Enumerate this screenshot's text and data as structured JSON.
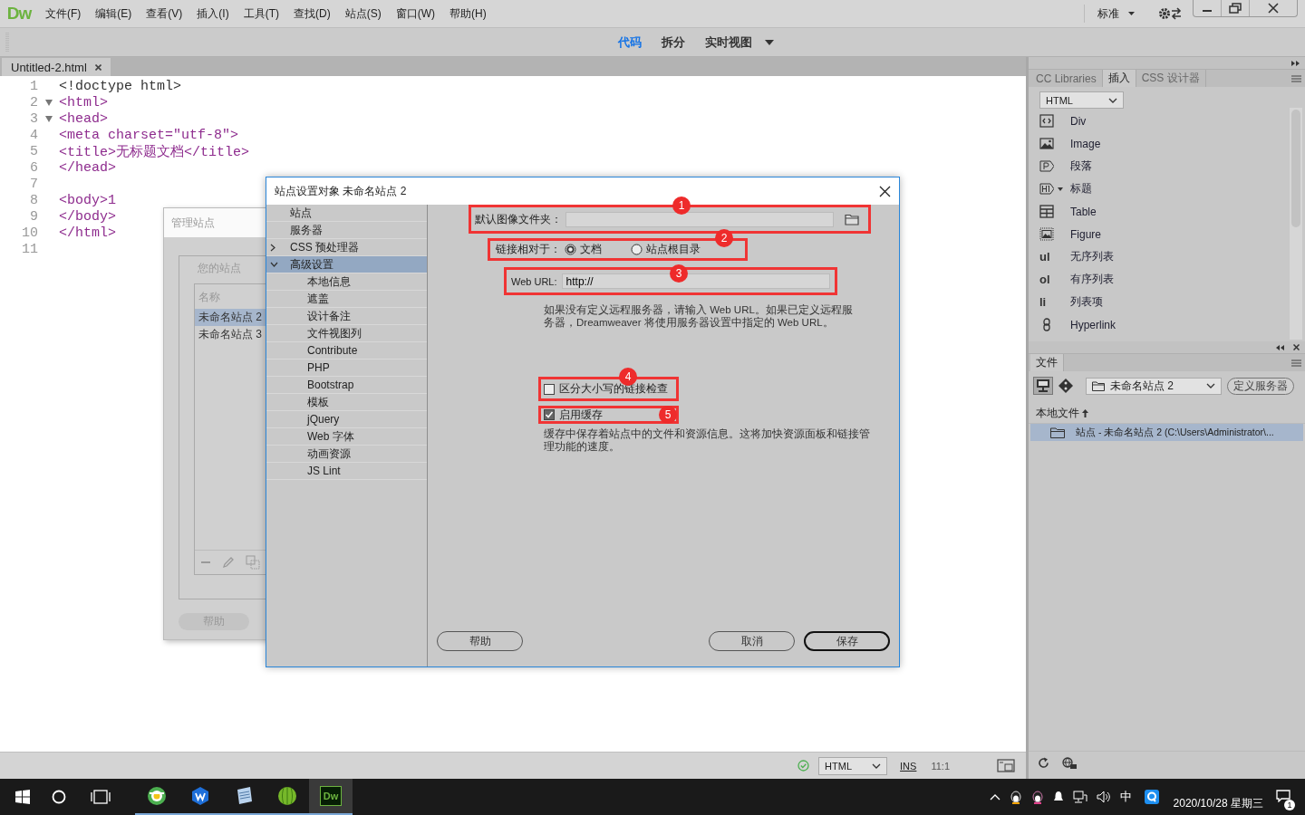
{
  "menubar": {
    "logo": "Dw",
    "menus": [
      "文件(F)",
      "编辑(E)",
      "查看(V)",
      "插入(I)",
      "工具(T)",
      "查找(D)",
      "站点(S)",
      "窗口(W)",
      "帮助(H)"
    ],
    "workspace": "标准"
  },
  "view_toolbar": {
    "buttons": [
      {
        "label": "代码",
        "selected": true
      },
      {
        "label": "拆分",
        "selected": false
      },
      {
        "label": "实时视图",
        "selected": false
      }
    ]
  },
  "document": {
    "tab": "Untitled-2.html",
    "lines": [
      {
        "number": "1",
        "text": "<!doctype html>",
        "kind": "doctype",
        "fold": false
      },
      {
        "number": "2",
        "text": "<html>",
        "kind": "tag",
        "fold": true
      },
      {
        "number": "3",
        "text": "<head>",
        "kind": "tag",
        "fold": true
      },
      {
        "number": "4",
        "text": "<meta charset=\"utf-8\">",
        "kind": "tag",
        "fold": false
      },
      {
        "number": "5",
        "text": "<title>无标题文档</title>",
        "kind": "tag",
        "fold": false
      },
      {
        "number": "6",
        "text": "</head>",
        "kind": "tag",
        "fold": false
      },
      {
        "number": "7",
        "fold": false
      },
      {
        "number": "8",
        "text": "<body>1",
        "kind": "tag",
        "fold": false
      },
      {
        "number": "9",
        "text": "</body>",
        "kind": "tag",
        "fold": false
      },
      {
        "number": "10",
        "text": "</html>",
        "kind": "tag",
        "fold": false
      },
      {
        "number": "11",
        "fold": false
      }
    ]
  },
  "status_bar": {
    "language": "HTML",
    "mode": "INS",
    "position": "11:1"
  },
  "insert_panel": {
    "tabs": [
      {
        "label": "CC Libraries",
        "selected": false
      },
      {
        "label": "插入",
        "selected": true
      },
      {
        "label": "CSS 设计器",
        "selected": false
      }
    ],
    "category": "HTML",
    "items": [
      {
        "label": "Div",
        "kind": "div"
      },
      {
        "label": "Image",
        "kind": "image"
      },
      {
        "label": "段落",
        "kind": "paragraph"
      },
      {
        "label": "标题",
        "kind": "heading"
      },
      {
        "label": "Table",
        "kind": "table"
      },
      {
        "label": "Figure",
        "kind": "figure"
      },
      {
        "label": "无序列表",
        "kind": "text",
        "icon_text": "ul"
      },
      {
        "label": "有序列表",
        "kind": "text",
        "icon_text": "ol"
      },
      {
        "label": "列表项",
        "kind": "text",
        "icon_text": "li"
      },
      {
        "label": "Hyperlink",
        "kind": "link"
      }
    ]
  },
  "files_panel": {
    "tab": "文件",
    "site": "未命名站点 2",
    "define_server": "定义服务器",
    "local_files": "本地文件",
    "rows": [
      {
        "label": "站点 - 未命名站点 2 (C:\\Users\\Administrator\\...",
        "selected": true
      }
    ]
  },
  "manage_sites_dialog": {
    "title": "管理站点",
    "section": "您的站点",
    "column": "名称",
    "sites": [
      {
        "name": "未命名站点 2",
        "selected": true
      },
      {
        "name": "未命名站点 3",
        "selected": false
      }
    ],
    "help": "帮助"
  },
  "site_setup_dialog": {
    "title": "站点设置对象 未命名站点 2",
    "categories": [
      {
        "label": "站点",
        "selected": false
      },
      {
        "label": "服务器",
        "selected": false
      },
      {
        "label": "CSS 预处理器",
        "selected": false,
        "expanded": false
      },
      {
        "label": "高级设置",
        "selected": true,
        "expanded": true,
        "children": [
          {
            "label": "本地信息",
            "selected": false
          },
          {
            "label": "遮盖",
            "selected": false
          },
          {
            "label": "设计备注",
            "selected": false
          },
          {
            "label": "文件视图列",
            "selected": false
          },
          {
            "label": "Contribute",
            "selected": false
          },
          {
            "label": "PHP",
            "selected": false
          },
          {
            "label": "Bootstrap",
            "selected": false
          },
          {
            "label": "模板",
            "selected": false
          },
          {
            "label": "jQuery",
            "selected": false
          },
          {
            "label": "Web 字体",
            "selected": false
          },
          {
            "label": "动画资源",
            "selected": false
          },
          {
            "label": "JS Lint",
            "selected": false
          }
        ]
      }
    ],
    "default_image_folder": {
      "label": "默认图像文件夹：",
      "annotation": "1"
    },
    "links_relative_to": {
      "label": "链接相对于：",
      "annotation": "2",
      "options": [
        {
          "label": "文档",
          "selected": true
        },
        {
          "label": "站点根目录",
          "selected": false
        }
      ]
    },
    "web_url": {
      "label": "Web URL:",
      "value": "http://",
      "annotation": "3"
    },
    "url_note": "如果没有定义远程服务器，请输入 Web URL。如果已定义远程服务器，Dreamweaver 将使用服务器设置中指定的 Web URL。",
    "checkboxes": [
      {
        "label": "区分大小写的链接检查",
        "checked": false,
        "annotation": "4"
      },
      {
        "label": "启用缓存",
        "checked": true,
        "annotation": "5"
      }
    ],
    "cache_note": "缓存中保存着站点中的文件和资源信息。这将加快资源面板和链接管理功能的速度。",
    "buttons": [
      {
        "label": "帮助",
        "kind": "help"
      },
      {
        "label": "取消",
        "kind": "cancel"
      },
      {
        "label": "保存",
        "kind": "default"
      }
    ]
  },
  "taskbar": {
    "apps": [
      {
        "kind": "browser",
        "selected": false
      },
      {
        "kind": "office",
        "selected": false
      },
      {
        "kind": "notepad",
        "selected": false
      },
      {
        "kind": "ball",
        "selected": false
      },
      {
        "kind": "dw",
        "label": "Dw",
        "selected": true
      }
    ],
    "ime": "中",
    "date": "2020/10/28 星期三",
    "notifications": "1"
  }
}
